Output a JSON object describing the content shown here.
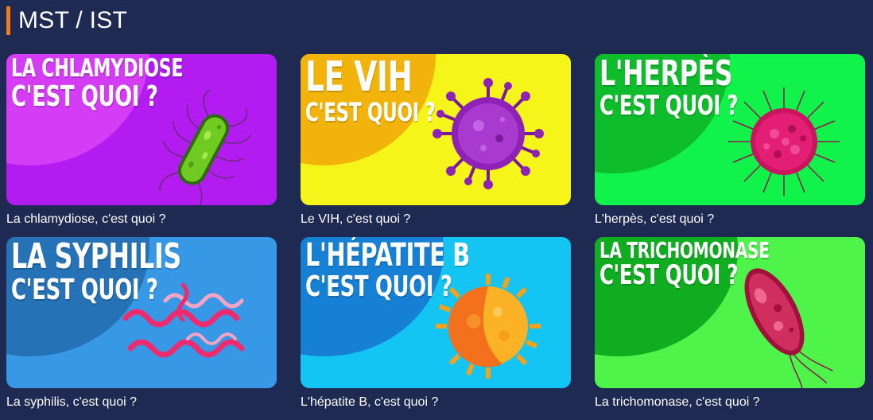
{
  "section": {
    "title": "MST / IST",
    "accent_color": "#f07c16"
  },
  "cards": [
    {
      "thumb_line1": "LA CHLAMYDIOSE",
      "thumb_line2": "C'EST QUOI ?",
      "caption": "La chlamydiose, c'est quoi ?",
      "bg": "#b31cf0",
      "blob": "#d53cf5",
      "illustration": "green-bacterium-icon"
    },
    {
      "thumb_line1": "LE VIH",
      "thumb_line2": "C'EST QUOI ?",
      "caption": "Le VIH, c'est quoi ?",
      "bg": "#f5f51a",
      "blob": "#f2b40a",
      "illustration": "purple-virus-icon"
    },
    {
      "thumb_line1": "L'HERPÈS",
      "thumb_line2": "C'EST QUOI ?",
      "caption": "L'herpès, c'est quoi ?",
      "bg": "#11f24a",
      "blob": "#0ebd2c",
      "illustration": "pink-virus-icon"
    },
    {
      "thumb_line1": "LA SYPHILIS",
      "thumb_line2": "C'EST QUOI ?",
      "caption": "La syphilis, c'est quoi ?",
      "bg": "#3799e6",
      "blob": "#2672b7",
      "illustration": "spirochete-icon"
    },
    {
      "thumb_line1": "L'HÉPATITE B",
      "thumb_line2": "C'EST QUOI ?",
      "caption": "L'hépatite B, c'est quoi ?",
      "bg": "#14c4f2",
      "blob": "#1680d4",
      "illustration": "orange-virus-icon"
    },
    {
      "thumb_line1": "LA TRICHOMONASE",
      "thumb_line2": "C'EST QUOI ?",
      "caption": "La trichomonase, c'est quoi ?",
      "bg": "#4ef44a",
      "blob": "#10ad21",
      "illustration": "trichomonas-icon"
    }
  ]
}
